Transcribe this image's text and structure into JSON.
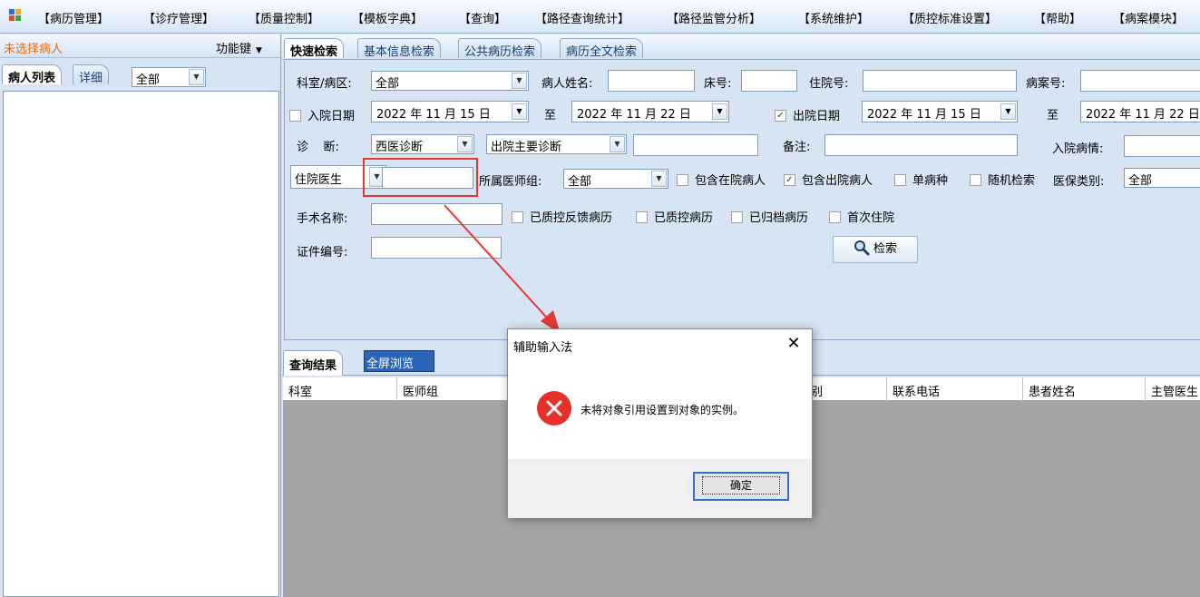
{
  "menu": [
    "【病历管理】",
    "【诊疗管理】",
    "【质量控制】",
    "【模板字典】",
    "【查询】",
    "【路径查询统计】",
    "【路径监管分析】",
    "【系统维护】",
    "【质控标准设置】",
    "【帮助】",
    "【病案模块】"
  ],
  "left_panel": {
    "no_patient": "未选择病人",
    "func_key": "功能键",
    "tabs": [
      "病人列表",
      "详细"
    ],
    "filter_value": "全部"
  },
  "search_tabs": [
    "快速检索",
    "基本信息检索",
    "公共病历检索",
    "病历全文检索"
  ],
  "form": {
    "dept_label": "科室/病区:",
    "dept_value": "全部",
    "patient_name_label": "病人姓名:",
    "bed_label": "床号:",
    "inpatient_no_label": "住院号:",
    "case_no_label": "病案号:",
    "admit_date_label": "入院日期",
    "admit_from": "2022 年 11 月 15 日",
    "to_1": "至",
    "admit_to": "2022 年 11 月 22 日",
    "discharge_date_label": "出院日期",
    "discharge_from": "2022 年 11 月 15 日",
    "to_2": "至",
    "discharge_to": "2022 年 11 月 22 日",
    "diagnosis_label": "诊    断:",
    "diagnosis_type": "西医诊断",
    "diagnosis_scope": "出院主要诊断",
    "remark_label": "备注:",
    "admit_condition_label": "入院病情:",
    "doctor_type": "住院医生",
    "doctor_group_label": "所属医师组:",
    "doctor_group_value": "全部",
    "include_inpatient": "包含在院病人",
    "include_discharged": "包含出院病人",
    "single_disease": "单病种",
    "random_search": "随机检索",
    "insurance_label": "医保类别:",
    "insurance_value": "全部",
    "surgery_label": "手术名称:",
    "qc_feedback": "已质控反馈病历",
    "qc_done": "已质控病历",
    "archived": "已归档病历",
    "first_admission": "首次住院",
    "id_no_label": "证件编号:",
    "search_button": "检索"
  },
  "results": {
    "tab_label": "查询结果",
    "fullscreen": "全屏浏览",
    "columns": [
      "科室",
      "医师组",
      "别",
      "联系电话",
      "患者姓名",
      "主管医生"
    ]
  },
  "dialog": {
    "title": "辅助输入法",
    "message": "未将对象引用设置到对象的实例。",
    "ok": "确定"
  },
  "colors": {
    "accent_orange": "#e46d0a",
    "highlight_red": "#e53935",
    "error_red": "#e7302a",
    "button_blue": "#2b65b8"
  }
}
